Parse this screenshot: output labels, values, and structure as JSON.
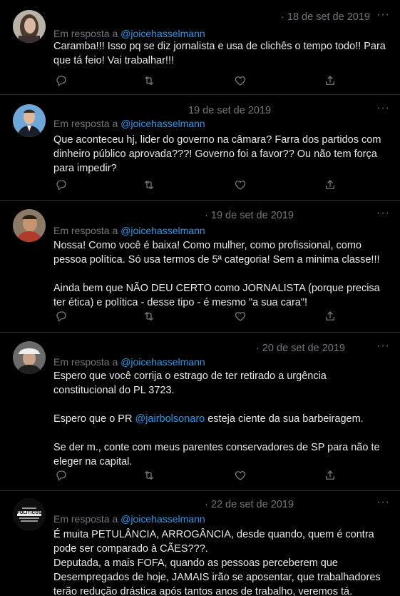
{
  "reply_prefix": "Em resposta a",
  "tweets": [
    {
      "date": "18 de set de 2019",
      "meta_prefix": "·",
      "reply_handle": "@joicehasselmann",
      "paragraphs": [
        "Caramba!!! Isso pq se diz jornalista e usa de clichês o tempo todo!! Para que tá feio! Vai trabalhar!!!"
      ],
      "more": "···"
    },
    {
      "date": "19 de set de 2019",
      "meta_prefix": "",
      "reply_handle": "@joicehasselmann",
      "paragraphs": [
        "Que aconteceu hj, lider do governo na câmara? Farra dos partidos com dinheiro público aprovada???! Governo foi a favor?? Ou não tem força para impedir?"
      ],
      "more": "···"
    },
    {
      "date": "19 de set de 2019",
      "meta_prefix": "·",
      "reply_handle": "@joicehasselmann",
      "paragraphs": [
        "Nossa! Como você é baixa! Como mulher, como profissional, como pessoa política. Só usa termos de 5ª categoria! Sem a minima classe!!!",
        "Ainda bem que NÃO DEU CERTO como JORNALISTA (porque precisa ter ética) e política - desse tipo - é mesmo \"a sua cara\"!"
      ],
      "more": "···"
    },
    {
      "date": "20 de set de 2019",
      "meta_prefix": "· ",
      "reply_handle": "@joicehasselmann",
      "paragraphs": [
        "Espero que você corrija o estrago de ter retirado a urgência constitucional do PL 3723.",
        "Espero que o PR @jairbolsonaro esteja ciente da sua barbeiragem.",
        "Se der m., conte com meus parentes conservadores de SP para não te eleger na capital."
      ],
      "mention": "@jairbolsonaro",
      "more": "···"
    },
    {
      "date": "22 de set de 2019",
      "meta_prefix": "·",
      "reply_handle": "@joicehasselmann",
      "paragraphs": [
        "É muita PETULÂNCIA, ARROGÂNCIA, desde quando, quem é contra pode ser comparado à CÃES???.",
        "Deputada, a mais FOFA, quando as pessoas perceberem que Desempregados de hoje, JAMAIS irão se aposentar, que trabalhadores terão redução drástica após tantos anos de trabalho, veremos tá."
      ],
      "more": "···"
    }
  ],
  "avatar5_text": "POLITICOS",
  "icons": [
    "reply-icon",
    "retweet-icon",
    "like-icon",
    "share-icon",
    "more-icon"
  ],
  "colors": {
    "background": "#000000",
    "text": "#e7e9ea",
    "muted": "#71767b",
    "link": "#1d9bf0",
    "divider": "#2f3336"
  }
}
